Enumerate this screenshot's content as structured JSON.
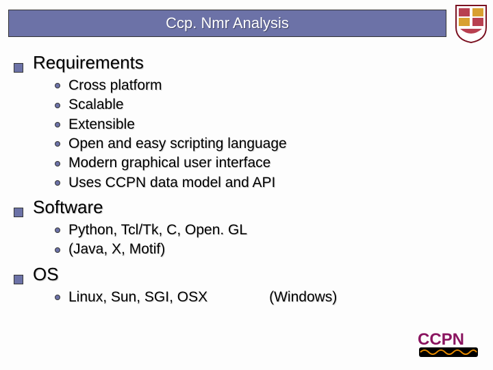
{
  "title": "Ccp. Nmr Analysis",
  "sections": [
    {
      "heading": "Requirements",
      "items": [
        "Cross platform",
        "Scalable",
        "Extensible",
        "Open and easy scripting language",
        "Modern graphical user interface",
        "Uses CCPN data model and API"
      ]
    },
    {
      "heading": "Software",
      "items": [
        "Python, Tcl/Tk, C, Open. GL",
        "(Java, X, Motif)"
      ]
    },
    {
      "heading": "OS",
      "items": [
        "Linux, Sun, SGI, OSX"
      ],
      "aside": "(Windows)"
    }
  ],
  "footer_logo_text": "CCPN",
  "colors": {
    "accent": "#6c72a7",
    "logo_magenta": "#8a1560"
  }
}
